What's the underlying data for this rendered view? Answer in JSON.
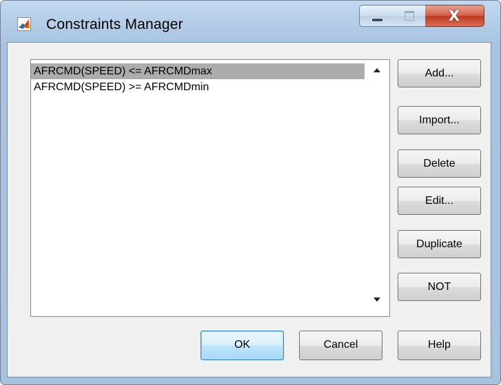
{
  "window": {
    "title": "Constraints Manager",
    "title_icon": "matlab-icon",
    "controls": {
      "minimize": "minimize-icon",
      "maximize": "maximize-icon",
      "close_glyph": "X"
    }
  },
  "constraints_list": {
    "items": [
      {
        "label": "AFRCMD(SPEED) <= AFRCMDmax",
        "selected": true
      },
      {
        "label": "AFRCMD(SPEED) >= AFRCMDmin",
        "selected": false
      }
    ]
  },
  "side_buttons": {
    "add": "Add...",
    "import": "Import...",
    "delete": "Delete",
    "edit": "Edit...",
    "duplicate": "Duplicate",
    "not": "NOT"
  },
  "footer_buttons": {
    "ok": "OK",
    "cancel": "Cancel",
    "help": "Help"
  },
  "colors": {
    "selection": "#acacac",
    "titlebar": "#b6cfe9",
    "close_button": "#c0391f",
    "default_button_border": "#3c7fb1"
  }
}
